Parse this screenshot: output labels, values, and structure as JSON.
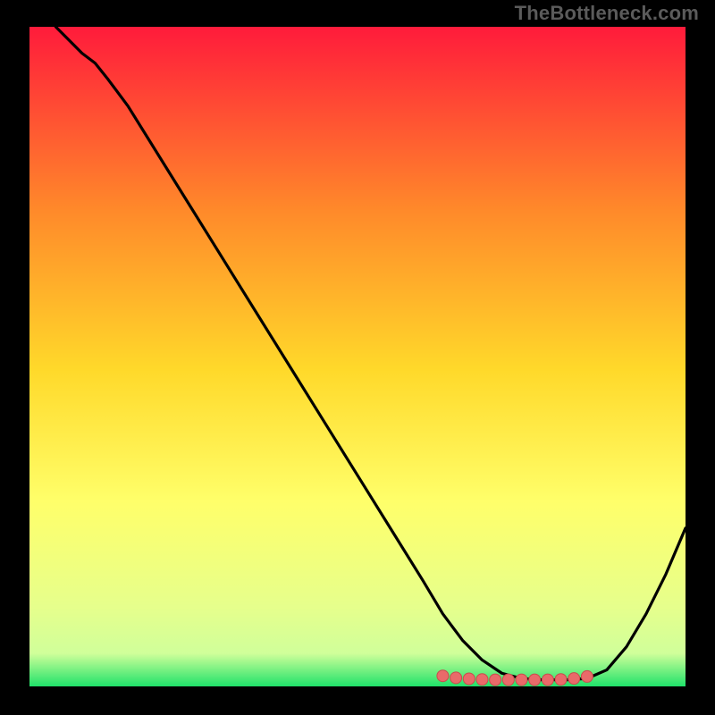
{
  "watermark": "TheBottleneck.com",
  "colors": {
    "grad_top": "#ff1b3b",
    "grad_mid_upper": "#ff8a2a",
    "grad_mid": "#ffd92a",
    "grad_mid_lower": "#ffff6a",
    "grad_near_bottom": "#e6ff8c",
    "grad_bottom": "#20e26a",
    "curve": "#000000",
    "dot_fill": "#e96a6a",
    "dot_stroke": "#c94d4d",
    "frame": "#000000"
  },
  "chart_data": {
    "type": "line",
    "title": "",
    "xlabel": "",
    "ylabel": "",
    "xlim": [
      0,
      100
    ],
    "ylim": [
      0,
      100
    ],
    "series": [
      {
        "name": "curve",
        "x": [
          4,
          6,
          8,
          10,
          12,
          15,
          20,
          25,
          30,
          35,
          40,
          45,
          50,
          55,
          60,
          63,
          66,
          69,
          72,
          75,
          78,
          80,
          82,
          85,
          88,
          91,
          94,
          97,
          100
        ],
        "y": [
          100,
          98,
          96,
          94.5,
          92,
          88,
          80,
          72,
          64,
          56,
          48,
          40,
          32,
          24,
          16,
          11,
          7,
          4,
          2,
          1.2,
          1.0,
          1.0,
          1.0,
          1.2,
          2.5,
          6,
          11,
          17,
          24
        ]
      }
    ],
    "dots": {
      "name": "highlight",
      "x": [
        63,
        65,
        67,
        69,
        71,
        73,
        75,
        77,
        79,
        81,
        83,
        85
      ],
      "y": [
        1.6,
        1.3,
        1.15,
        1.05,
        1.0,
        1.0,
        1.0,
        1.0,
        1.0,
        1.05,
        1.2,
        1.5
      ]
    }
  }
}
